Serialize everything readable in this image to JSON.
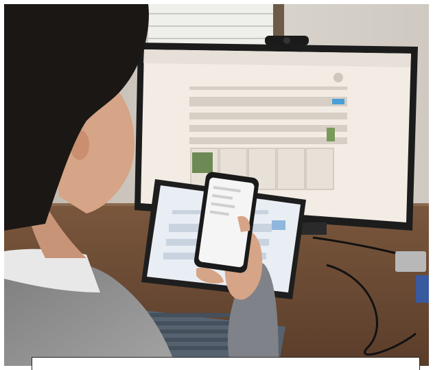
{
  "scene": {
    "subject": "person-using-devices",
    "colors": {
      "wall": "#d8d3cc",
      "desk": "#6b4a33",
      "monitor_bezel": "#1c1c1c",
      "monitor_screen": "#f3ece4",
      "tablet_screen": "#e9eef5",
      "keyboard": "#56626f",
      "phone_screen": "#f5f5f5",
      "shirt": "#8e8e8e",
      "hair": "#1b1714",
      "skin": "#d6a486"
    }
  }
}
